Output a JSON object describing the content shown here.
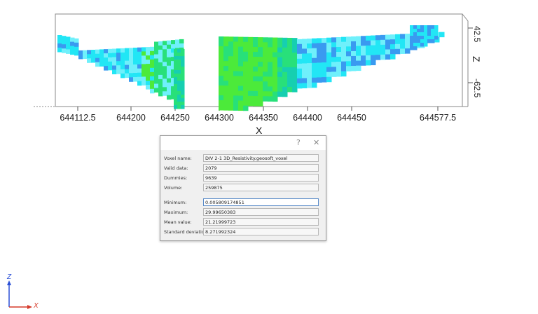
{
  "viewport": {
    "x_axis": {
      "title": "X",
      "ticks": [
        "644112.5",
        "644200",
        "644250",
        "644300",
        "644350",
        "644400",
        "644450",
        "644577.5"
      ]
    },
    "z_axis": {
      "title": "Z",
      "ticks": [
        "42.5",
        "-62.5"
      ]
    },
    "colors": {
      "cyan": "#22e6f5",
      "light_cyan": "#6ff0fb",
      "teal": "#16cfb0",
      "green": "#28e07a",
      "bright_green": "#4cea3a",
      "blue": "#3a9af0",
      "box_line": "#8a8a8a"
    }
  },
  "dialog": {
    "title": "",
    "help_label": "?",
    "close_label": "✕",
    "fields": [
      {
        "label": "Voxel name:",
        "value": "DIV 2-1 3D_Resistivity.geosoft_voxel"
      },
      {
        "label": "Valid data:",
        "value": "2079"
      },
      {
        "label": "Dummies:",
        "value": "9639"
      },
      {
        "label": "Volume:",
        "value": "259875"
      },
      {
        "label": "Minimum:",
        "value": "0.005809174851"
      },
      {
        "label": "Maximum:",
        "value": "29.99650383"
      },
      {
        "label": "Mean value:",
        "value": "21.21999723"
      },
      {
        "label": "Standard deviation:",
        "value": "8.271992324"
      }
    ]
  },
  "triad": {
    "z_label": "Z",
    "x_label": "X"
  }
}
